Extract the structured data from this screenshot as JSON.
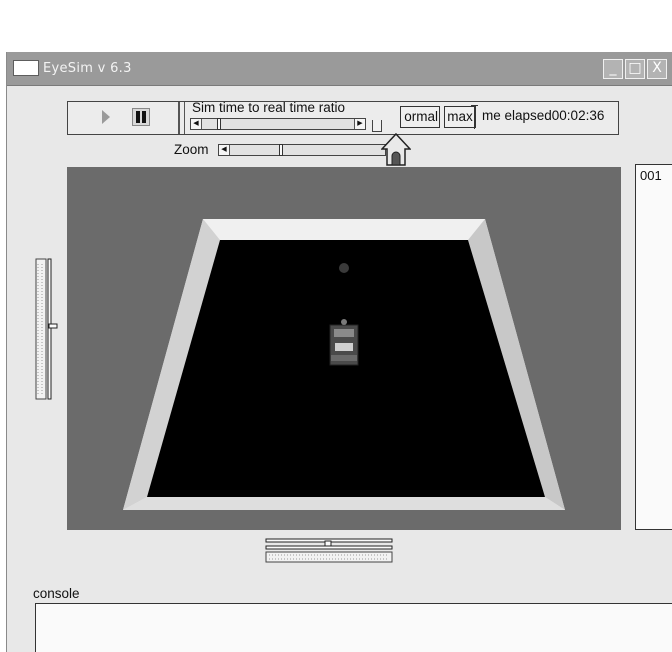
{
  "window": {
    "title": "EyeSim v 6.3"
  },
  "titlebar": {
    "minimize_glyph": "_",
    "maximize_glyph": "□",
    "close_glyph": "X"
  },
  "toolbar": {
    "play_icon": "play-icon",
    "pause_icon": "pause-icon",
    "ratio_label": "Sim time to real time ratio",
    "normal_label": "ormal",
    "max_label": "max",
    "time_elapsed": "me elapsed00:02:36"
  },
  "zoom": {
    "label": "Zoom",
    "home_icon": "home-icon"
  },
  "side_panel": {
    "text": "001"
  },
  "console": {
    "label": "console",
    "value": ""
  },
  "colors": {
    "titlebar": "#9a9a9a",
    "viewport_bg": "#6b6b6b",
    "arena_floor": "#000000",
    "arena_wall": "#f2f2f2"
  }
}
